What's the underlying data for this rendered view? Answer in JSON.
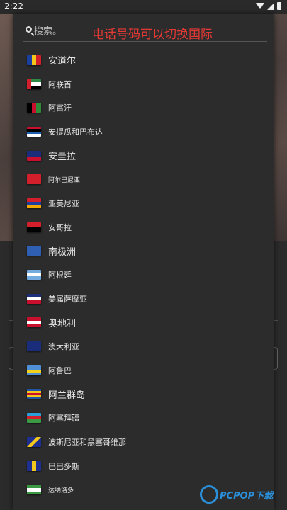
{
  "status_bar": {
    "time": "2:22"
  },
  "search": {
    "placeholder": "搜索。"
  },
  "annotation": "电话号码可以切换国际",
  "countries": [
    {
      "name": "安道尔",
      "size": "l",
      "flag": [
        "#1b3fa0",
        "#f3c71b",
        "#d31f2c"
      ],
      "dir": "v"
    },
    {
      "name": "阿联首",
      "size": "m",
      "flag": [
        "#2d8a45",
        "#ffffff",
        "#000000"
      ],
      "dir": "h",
      "hoist": "#d31f2c"
    },
    {
      "name": "阿富汗",
      "size": "m",
      "flag": [
        "#000000",
        "#c8102e",
        "#2e8b3a"
      ],
      "dir": "v"
    },
    {
      "name": "安提瓜和巴布达",
      "size": "m",
      "flag": [
        "#c8102e",
        "#000000",
        "#1e5fb0",
        "#ffffff"
      ],
      "dir": "h"
    },
    {
      "name": "安圭拉",
      "size": "l",
      "flag": [
        "#1a2d7a",
        "#1a2d7a",
        "#c8102e"
      ],
      "dir": "h"
    },
    {
      "name": "阿尔巴尼亚",
      "size": "s",
      "flag": [
        "#d31f2c"
      ],
      "dir": "h"
    },
    {
      "name": "亚美尼亚",
      "size": "m",
      "flag": [
        "#d31f2c",
        "#1d3fa0",
        "#f2a800"
      ],
      "dir": "h"
    },
    {
      "name": "安哥拉",
      "size": "m",
      "flag": [
        "#d31f2c",
        "#000000"
      ],
      "dir": "h"
    },
    {
      "name": "南极洲",
      "size": "l",
      "flag": [
        "#2f5fb3"
      ],
      "dir": "h"
    },
    {
      "name": "阿根廷",
      "size": "m",
      "flag": [
        "#74acdf",
        "#ffffff",
        "#74acdf"
      ],
      "dir": "h"
    },
    {
      "name": "美属萨摩亚",
      "size": "m",
      "flag": [
        "#1b2f7a",
        "#ffffff",
        "#c8102e"
      ],
      "dir": "h"
    },
    {
      "name": "奥地利",
      "size": "l",
      "flag": [
        "#c8102e",
        "#ffffff",
        "#c8102e"
      ],
      "dir": "h"
    },
    {
      "name": "澳大利亚",
      "size": "m",
      "flag": [
        "#1a2d7a"
      ],
      "dir": "h"
    },
    {
      "name": "阿鲁巴",
      "size": "m",
      "flag": [
        "#4f8fd6",
        "#4f8fd6",
        "#f3d21b",
        "#4f8fd6"
      ],
      "dir": "h"
    },
    {
      "name": "阿兰群岛",
      "size": "l",
      "flag": [
        "#1f55a8",
        "#f3c71b",
        "#c8102e",
        "#f3c71b",
        "#1f55a8"
      ],
      "dir": "h"
    },
    {
      "name": "阿塞拜疆",
      "size": "m",
      "flag": [
        "#2aa0d8",
        "#d31f2c",
        "#3a9a43"
      ],
      "dir": "h"
    },
    {
      "name": "波斯尼亚和黑塞哥维那",
      "size": "m",
      "flag": [
        "#1f2f8f",
        "#f3c71b"
      ],
      "dir": "diag"
    },
    {
      "name": "巴巴多斯",
      "size": "m",
      "flag": [
        "#1f2f8f",
        "#f3c71b",
        "#1f2f8f"
      ],
      "dir": "v"
    },
    {
      "name": "达纳洛多",
      "size": "s",
      "flag": [
        "#3a9a43",
        "#ffffff",
        "#3a9a43"
      ],
      "dir": "h"
    }
  ],
  "watermark": {
    "brand": "PCPOP下载"
  }
}
